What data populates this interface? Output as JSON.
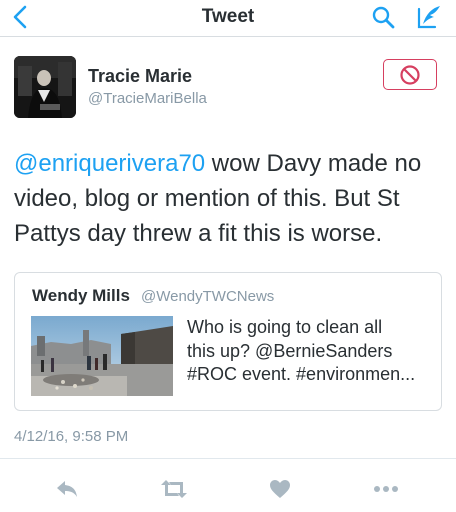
{
  "nav": {
    "title": "Tweet",
    "back_icon": "chevron-left-icon",
    "search_icon": "search-icon",
    "compose_icon": "compose-quill-icon"
  },
  "author": {
    "name": "Tracie Marie",
    "handle": "@TracieMariBella",
    "avatar_icon": "avatar-photo",
    "block_icon": "block-icon"
  },
  "tweet": {
    "mention": "@enriquerivera70",
    "text": " wow Davy made no video, blog or mention of this. But St Pattys day threw a fit this is worse."
  },
  "quoted_tweet": {
    "name": "Wendy Mills",
    "handle": "@WendyTWCNews",
    "text_lines": [
      "Who is going to clean all",
      "this up? @BernieSanders",
      "#ROC event. #environmen..."
    ],
    "media_icon": "photo-thumbnail"
  },
  "timestamp": "4/12/16, 9:58 PM",
  "actions": [
    {
      "name": "reply-icon"
    },
    {
      "name": "retweet-icon"
    },
    {
      "name": "like-heart-icon"
    },
    {
      "name": "more-dots-icon"
    }
  ],
  "colors": {
    "accent": "#1da1f2",
    "block_red": "#d63f60",
    "text": "#292f33",
    "secondary_text": "#8899a6",
    "icon_gray": "#aab8c2",
    "border": "#d8dde1"
  }
}
